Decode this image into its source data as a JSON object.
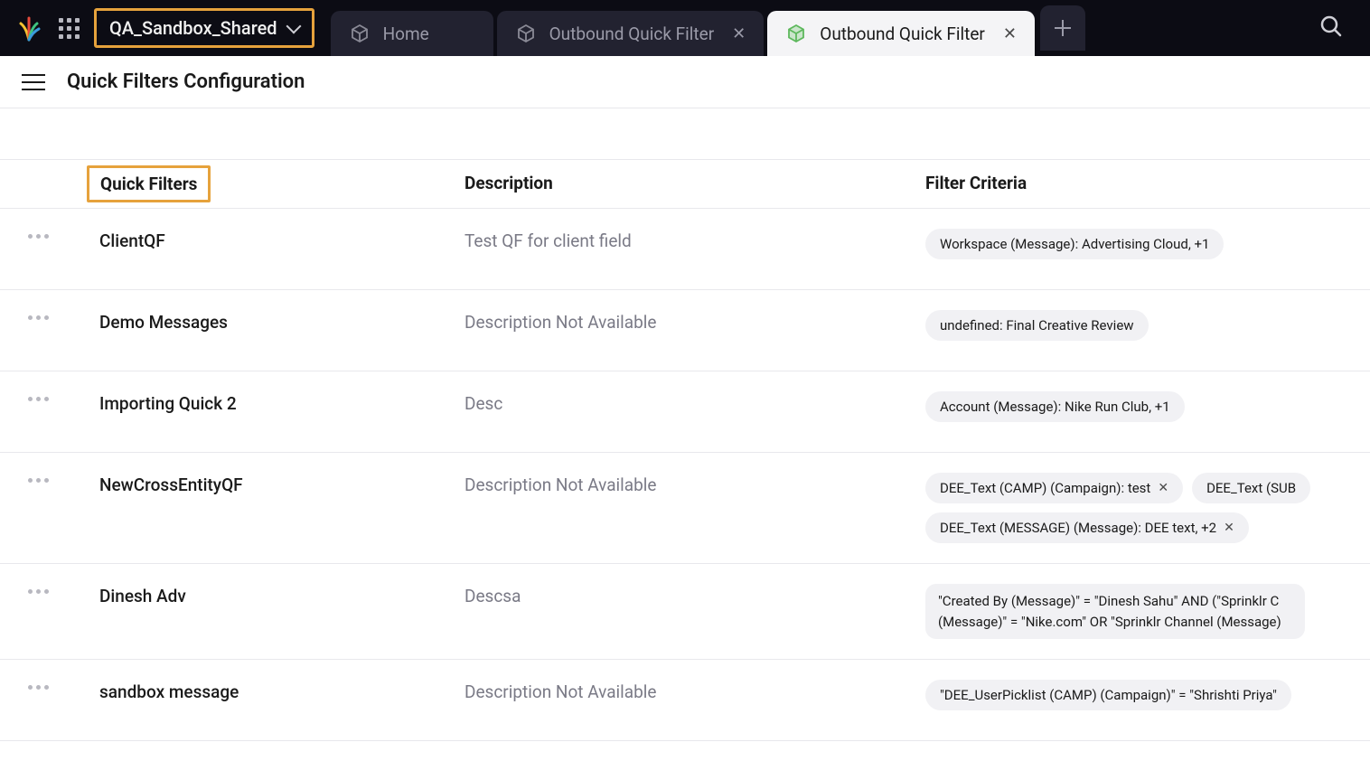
{
  "workspace": {
    "name": "QA_Sandbox_Shared"
  },
  "tabs": [
    {
      "label": "Home",
      "icon": "cube",
      "active": false,
      "closable": false
    },
    {
      "label": "Outbound Quick Filter",
      "icon": "cube",
      "active": false,
      "closable": true
    },
    {
      "label": "Outbound Quick Filter",
      "icon": "cube-green",
      "active": true,
      "closable": true
    }
  ],
  "page": {
    "title": "Quick Filters Configuration"
  },
  "table": {
    "headers": {
      "name": "Quick Filters",
      "description": "Description",
      "criteria": "Filter Criteria"
    },
    "rows": [
      {
        "name": "ClientQF",
        "description": "Test QF for client field",
        "criteria": [
          {
            "text": "Workspace (Message): Advertising Cloud, +1",
            "closable": false
          }
        ]
      },
      {
        "name": "Demo Messages",
        "description": "Description Not Available",
        "criteria": [
          {
            "text": "undefined: Final Creative Review",
            "closable": false
          }
        ]
      },
      {
        "name": "Importing Quick 2",
        "description": "Desc",
        "criteria": [
          {
            "text": "Account (Message): Nike Run Club, +1",
            "closable": false
          }
        ]
      },
      {
        "name": "NewCrossEntityQF",
        "description": "Description Not Available",
        "criteria": [
          {
            "text": "DEE_Text (CAMP) (Campaign): test",
            "closable": true
          },
          {
            "text": "DEE_Text (SUB",
            "closable": false
          },
          {
            "text": "DEE_Text (MESSAGE) (Message): DEE text, +2",
            "closable": true
          }
        ]
      },
      {
        "name": "Dinesh Adv",
        "description": "Descsa",
        "criteria": [
          {
            "text": "\"Created By (Message)\" = \"Dinesh Sahu\" AND (\"Sprinklr C (Message)\" = \"Nike.com\" OR \"Sprinklr Channel (Message)",
            "closable": false,
            "long": true
          }
        ]
      },
      {
        "name": "sandbox message",
        "description": "Description Not Available",
        "criteria": [
          {
            "text": "\"DEE_UserPicklist (CAMP) (Campaign)\" = \"Shrishti Priya\" ",
            "closable": false
          }
        ]
      }
    ]
  }
}
